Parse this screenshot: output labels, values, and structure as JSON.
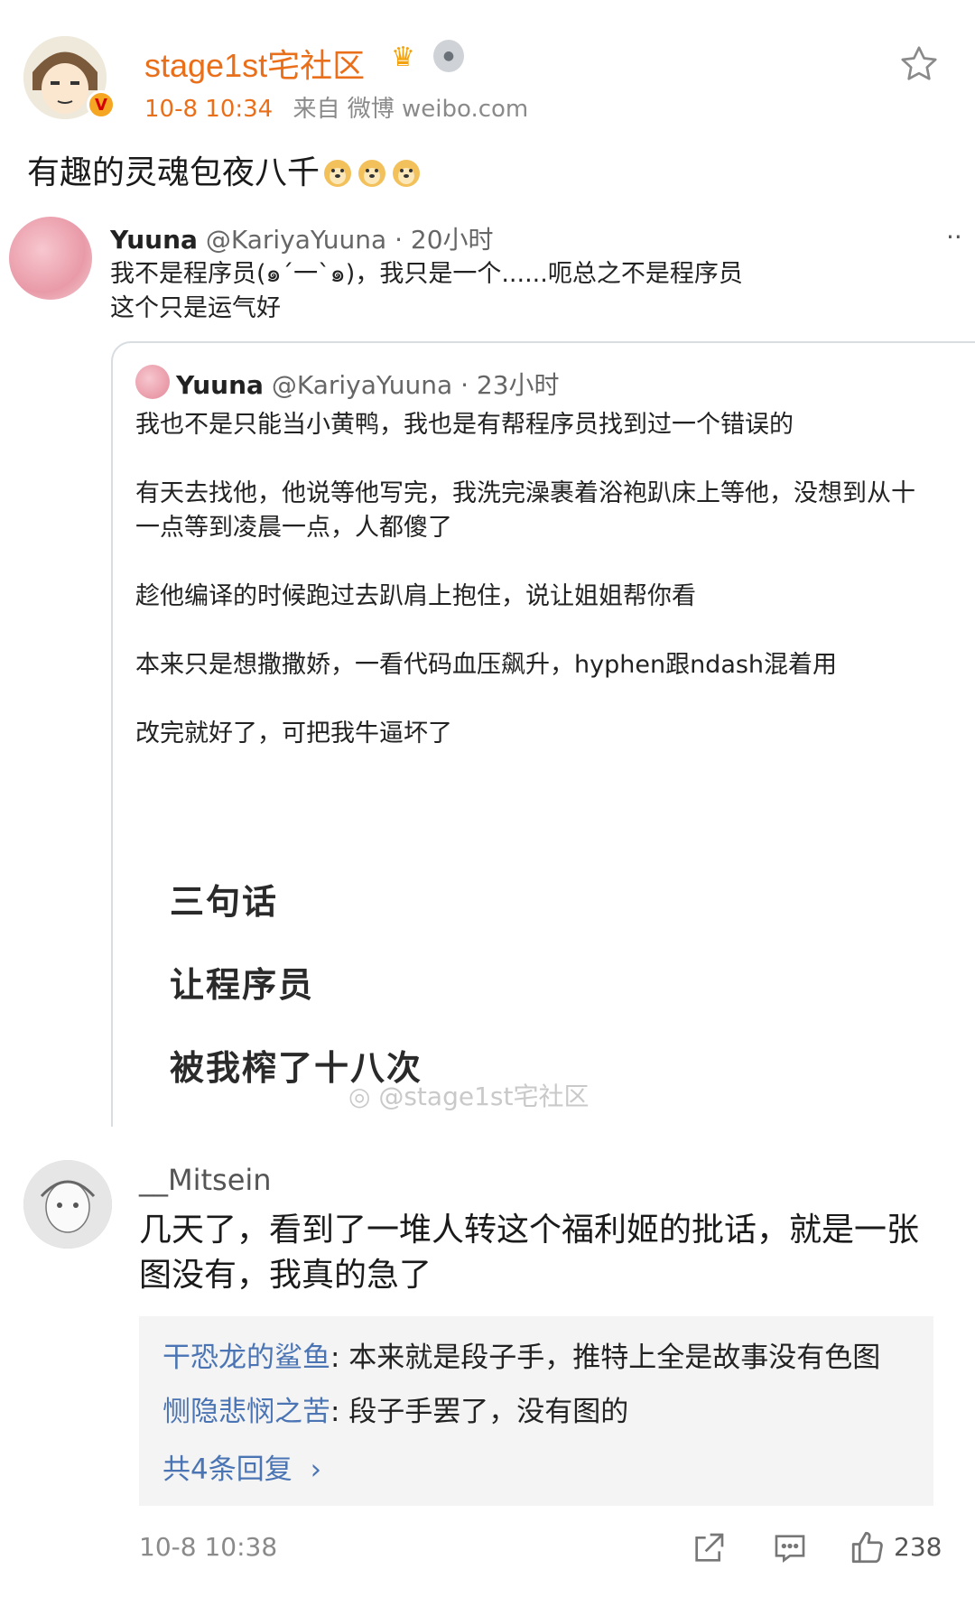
{
  "post": {
    "username": "stage1st宅社区",
    "time": "10-8 10:34",
    "source_prefix": "来自",
    "source": "微博 weibo.com",
    "text": "有趣的灵魂包夜八千"
  },
  "tweet": {
    "name": "Yuuna",
    "handle": "@KariyaYuuna · 20小时",
    "line1": "我不是程序员(๑ˊ一ˋ๑)，我只是一个......呃总之不是程序员",
    "line2": "这个只是运气好"
  },
  "quoted": {
    "name": "Yuuna",
    "handle": "@KariyaYuuna · 23小时",
    "p1": "我也不是只能当小黄鸭，我也是有帮程序员找到过一个错误的",
    "p2a": "有天去找他，他说等他写完，我洗完澡裹着浴袍趴床上等他，没想到从十",
    "p2b": "一点等到凌晨一点，人都傻了",
    "p3": "趁他编译的时候跑过去趴肩上抱住，说让姐姐帮你看",
    "p4": "本来只是想撒撒娇，一看代码血压飙升，hyphen跟ndash混着用",
    "p5": "改完就好了，可把我牛逼坏了",
    "big1": "三句话",
    "big2": "让程序员",
    "big3": "被我榨了十八次",
    "watermark": "@stage1st宅社区"
  },
  "comment": {
    "username": "__Mitsein",
    "text": "几天了，看到了一堆人转这个福利姬的批话，就是一张图没有，我真的急了",
    "replies": [
      {
        "name": "干恐龙的鲨鱼",
        "text": ": 本来就是段子手，推特上全是故事没有色图"
      },
      {
        "name": "恻隐悲悯之苦",
        "text": ": 段子手罢了，没有图的"
      }
    ],
    "more_replies": "共4条回复",
    "time": "10-8 10:38",
    "likes": "238"
  }
}
